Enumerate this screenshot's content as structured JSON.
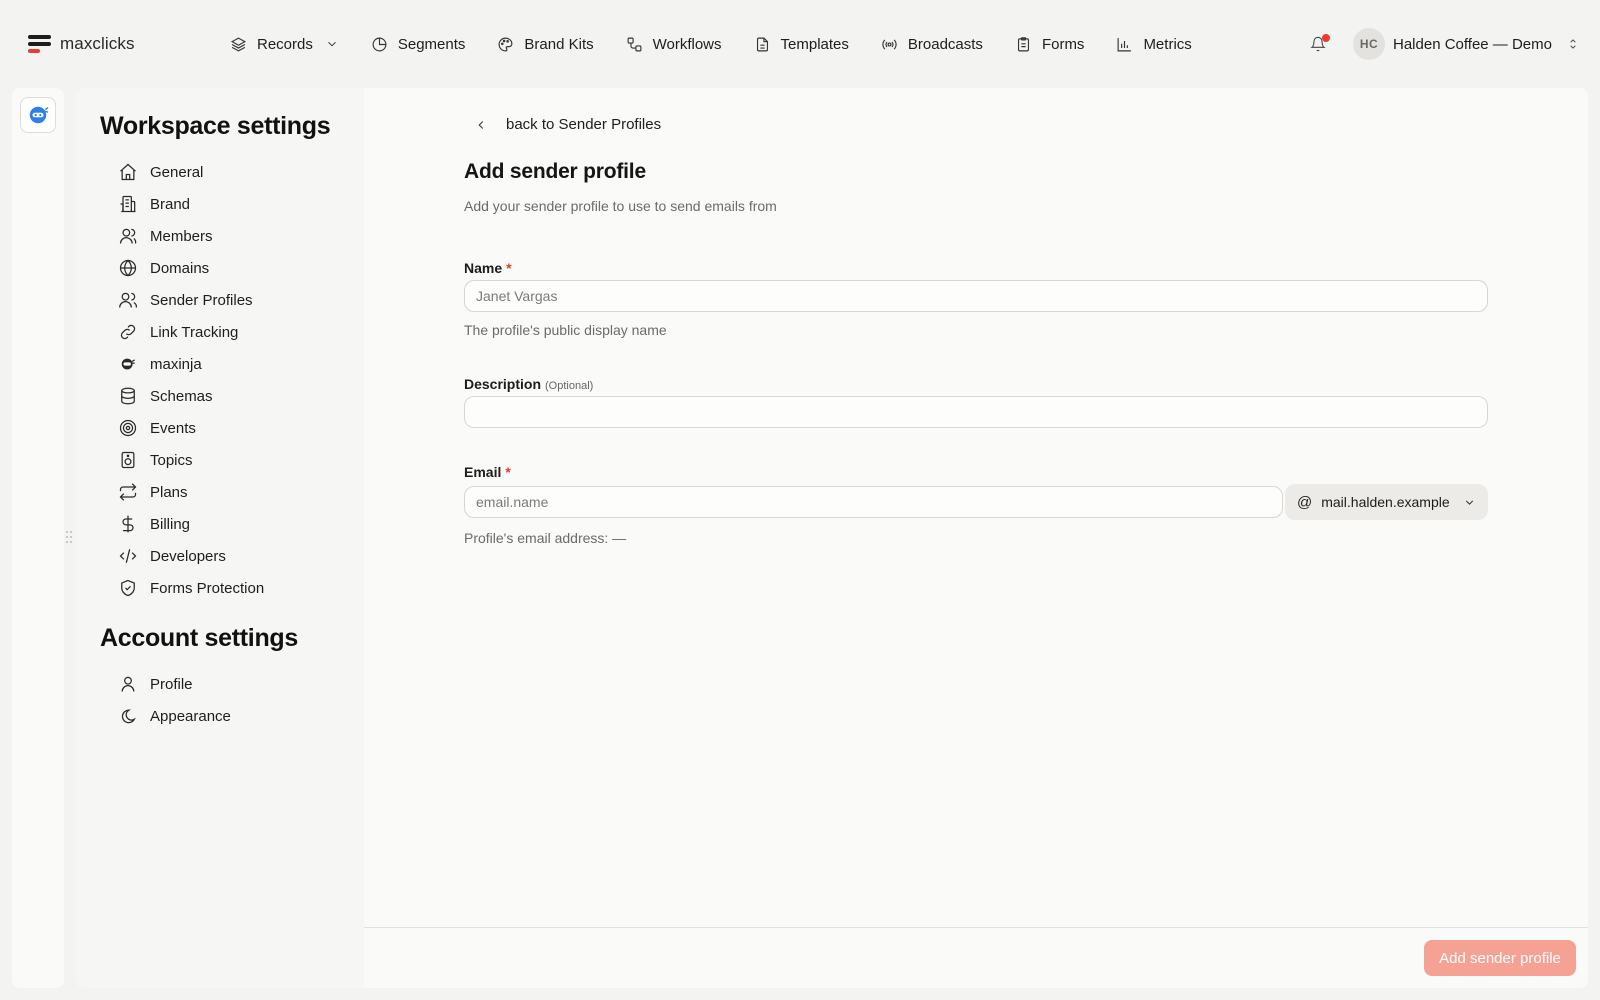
{
  "app": {
    "logo_text": "maxclicks"
  },
  "nav": {
    "items": [
      {
        "label": "Records",
        "icon": "layers-icon"
      },
      {
        "label": "Segments",
        "icon": "pie-icon"
      },
      {
        "label": "Brand Kits",
        "icon": "palette-icon"
      },
      {
        "label": "Workflows",
        "icon": "workflow-icon"
      },
      {
        "label": "Templates",
        "icon": "document-icon"
      },
      {
        "label": "Broadcasts",
        "icon": "broadcast-icon"
      },
      {
        "label": "Forms",
        "icon": "clipboard-icon"
      },
      {
        "label": "Metrics",
        "icon": "bar-chart-icon"
      }
    ]
  },
  "account": {
    "initials": "HC",
    "name": "Halden Coffee — Demo"
  },
  "colors": {
    "accent": "#ef3b2d",
    "submit_disabled": "#f5a295",
    "rail_icon": "#2f7fe8"
  },
  "sidebar": {
    "workspace_title": "Workspace settings",
    "workspace_items": [
      {
        "label": "General",
        "icon": "home-icon"
      },
      {
        "label": "Brand",
        "icon": "building-icon"
      },
      {
        "label": "Members",
        "icon": "user-icon"
      },
      {
        "label": "Domains",
        "icon": "globe-icon"
      },
      {
        "label": "Sender Profiles",
        "icon": "users-icon"
      },
      {
        "label": "Link Tracking",
        "icon": "link-icon"
      },
      {
        "label": "maxinja",
        "icon": "ninja-icon"
      },
      {
        "label": "Schemas",
        "icon": "database-icon"
      },
      {
        "label": "Events",
        "icon": "target-icon"
      },
      {
        "label": "Topics",
        "icon": "speaker-icon"
      },
      {
        "label": "Plans",
        "icon": "repeat-icon"
      },
      {
        "label": "Billing",
        "icon": "dollar-icon"
      },
      {
        "label": "Developers",
        "icon": "code-icon"
      },
      {
        "label": "Forms Protection",
        "icon": "shield-icon"
      }
    ],
    "account_title": "Account settings",
    "account_items": [
      {
        "label": "Profile",
        "icon": "person-icon"
      },
      {
        "label": "Appearance",
        "icon": "moon-icon"
      }
    ]
  },
  "form": {
    "back_label": "back to Sender Profiles",
    "title": "Add sender profile",
    "subtitle": "Add your sender profile to use to send emails from",
    "name": {
      "label": "Name",
      "required_mark": "*",
      "placeholder": "Janet Vargas",
      "value": "",
      "hint": "The profile's public display name"
    },
    "description": {
      "label": "Description",
      "optional_label": "(Optional)",
      "placeholder": "",
      "value": ""
    },
    "email": {
      "label": "Email",
      "required_mark": "*",
      "placeholder": "email.name",
      "value": "",
      "at_symbol": "@",
      "domain": "mail.halden.example",
      "hint": "Profile's email address: —"
    },
    "submit_label": "Add sender profile"
  }
}
